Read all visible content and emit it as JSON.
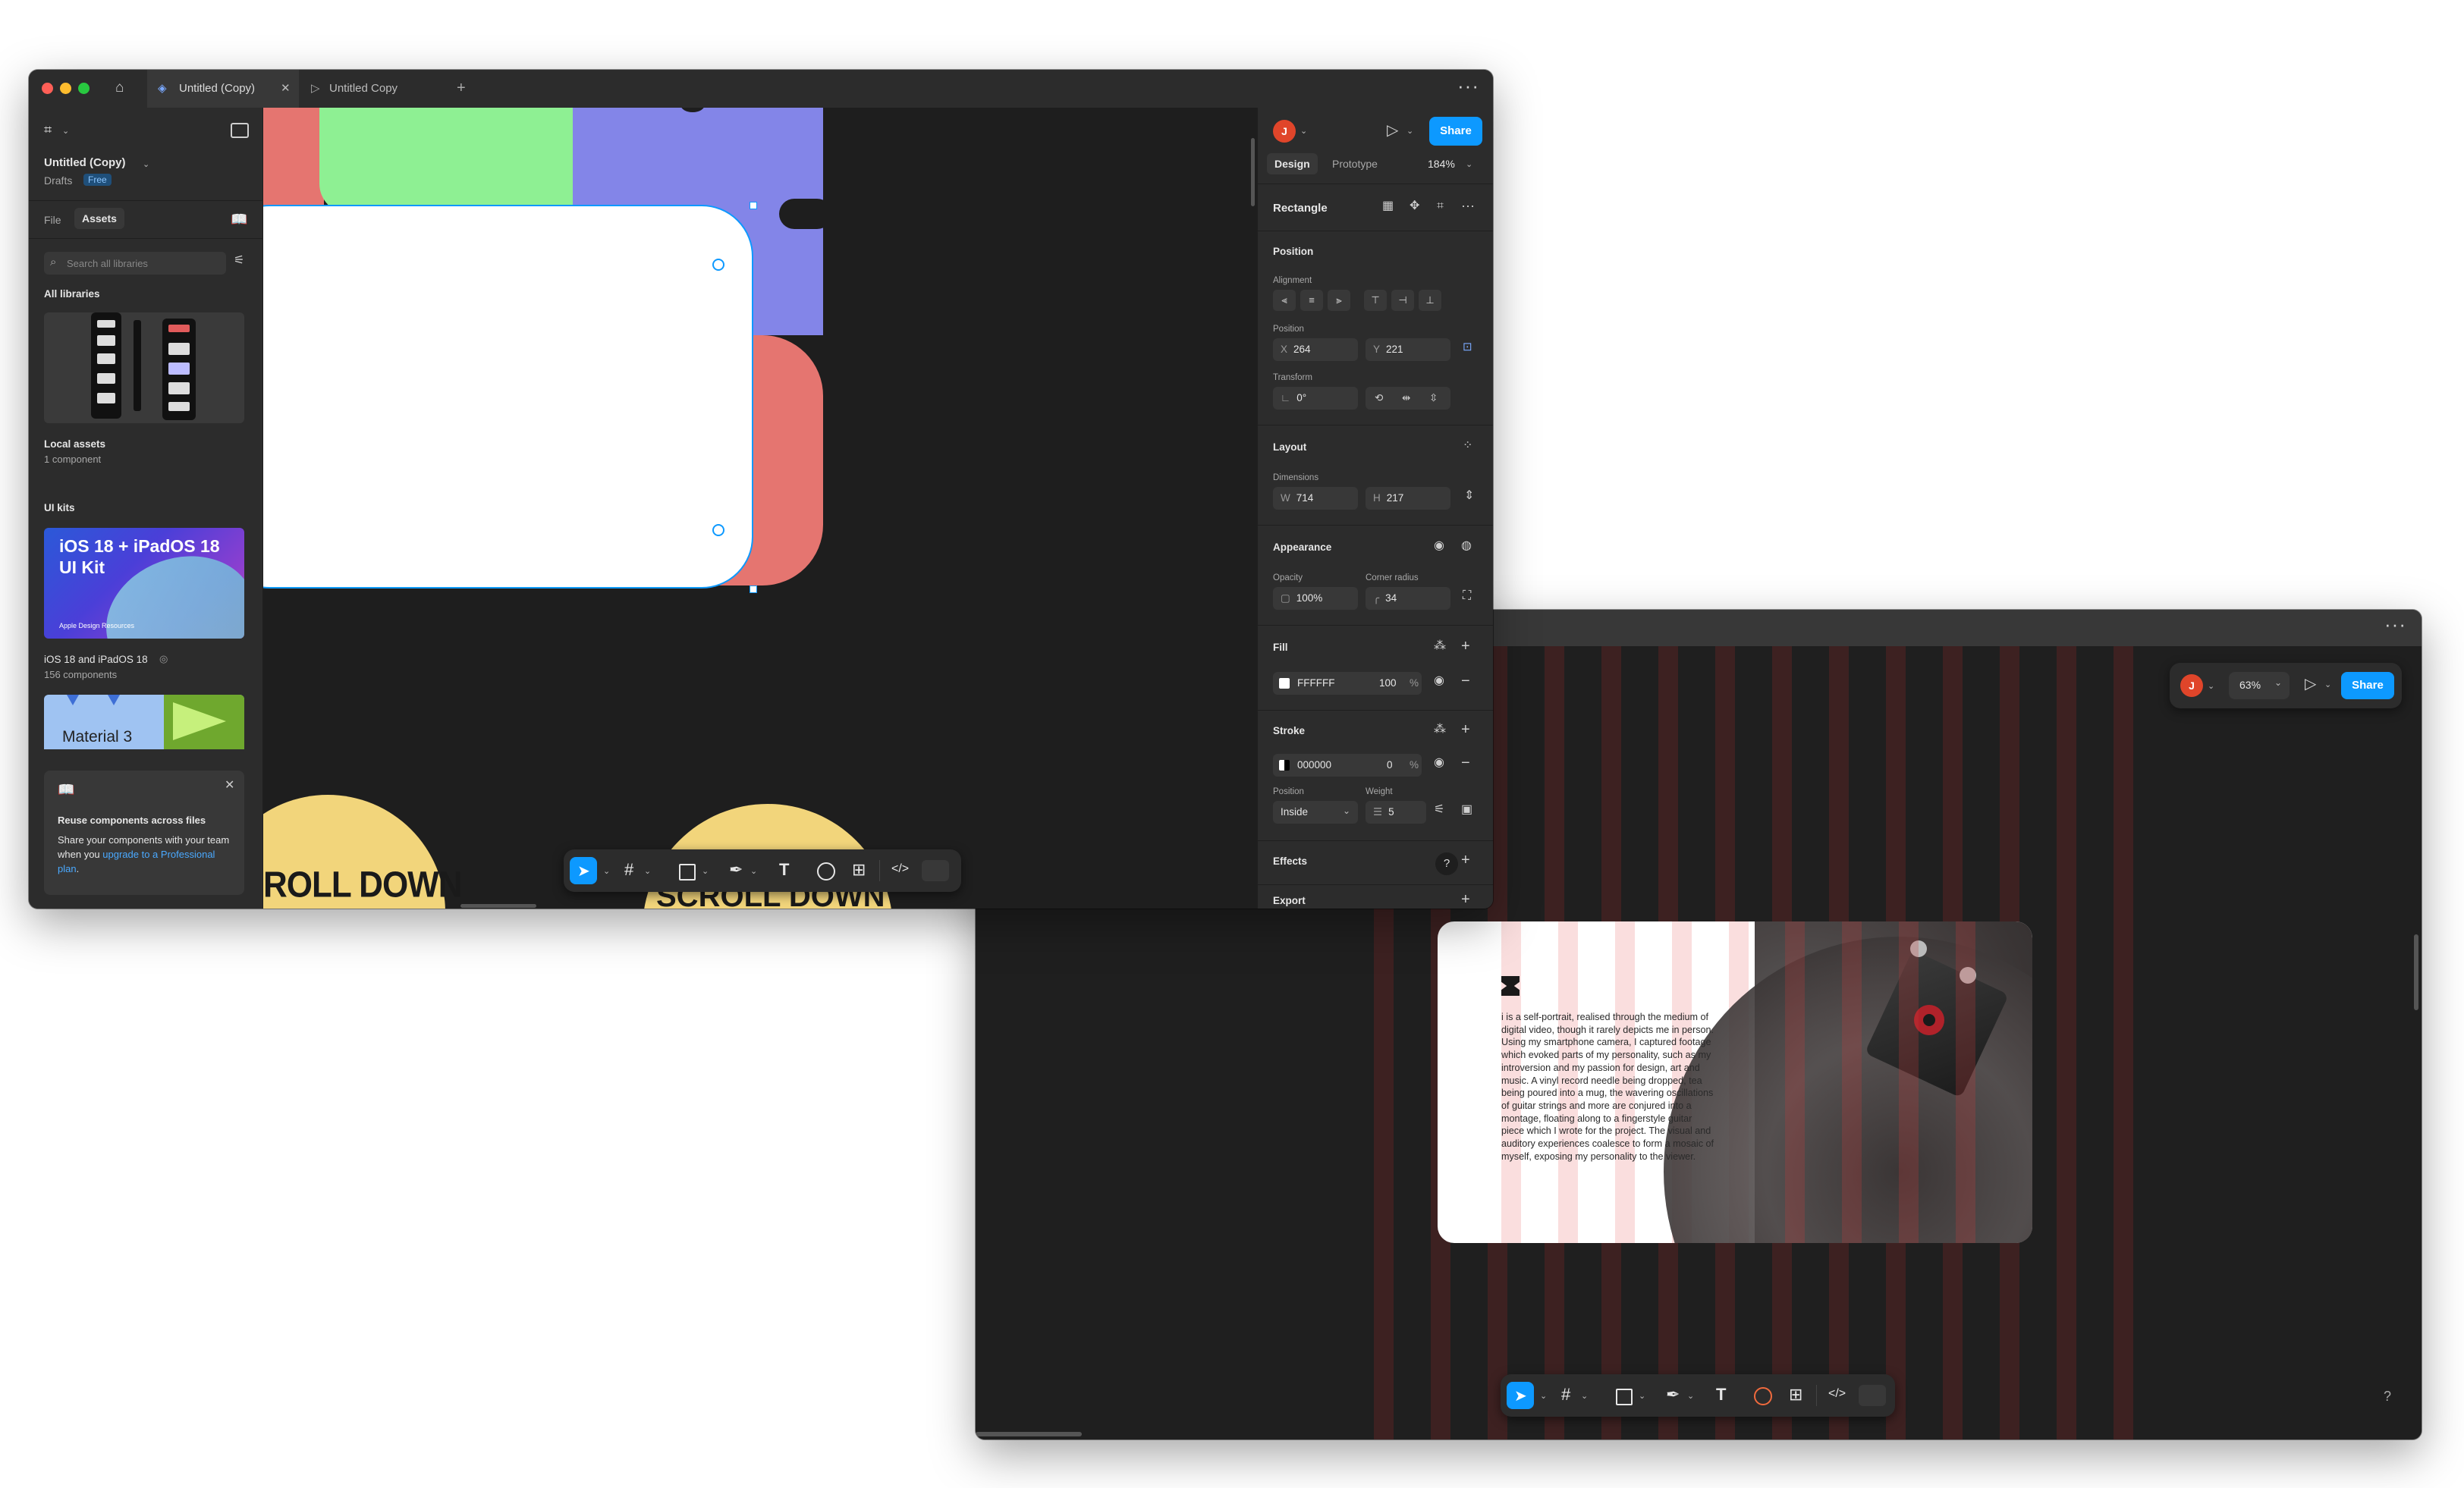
{
  "back_window": {
    "more_label": "···",
    "avatar_initial": "J",
    "zoom": "63%",
    "share_label": "Share",
    "help_label": "?",
    "card": {
      "body_text": "i is a self-portrait, realised through the medium of digital video, though it rarely depicts me in person. Using my smartphone camera, I captured footage which evoked parts of my personality, such as my introversion and my passion for design, art and music. A vinyl record needle being dropped, tea being poured into a mug, the wavering oscillations of guitar strings and more are conjured into a montage, floating along to a fingerstyle guitar piece which I wrote for the project. The visual and auditory experiences coalesce to form a mosaic of myself, exposing my personality to the viewer."
    }
  },
  "front_window": {
    "tabs": [
      {
        "label": "Untitled (Copy)",
        "icon": "figma-file-icon",
        "active": true,
        "close": "✕"
      },
      {
        "label": "Untitled Copy",
        "icon": "play-icon",
        "active": false
      }
    ],
    "new_tab_label": "+",
    "more_label": "···",
    "left_panel": {
      "file_title": "Untitled (Copy)",
      "location": "Drafts",
      "plan_badge": "Free",
      "tab_file": "File",
      "tab_assets": "Assets",
      "search_placeholder": "Search all libraries",
      "all_libraries_label": "All libraries",
      "local_assets": {
        "title": "Local assets",
        "subtitle": "1 component"
      },
      "ui_kits_label": "UI kits",
      "ios_kit": {
        "thumb_title": "iOS 18 + iPadOS 18 UI Kit",
        "thumb_footer": "Apple Design Resources",
        "title": "iOS 18 and iPadOS 18",
        "subtitle": "156 components"
      },
      "material_kit": {
        "thumb_title": "Material 3"
      },
      "promo": {
        "title": "Reuse components across files",
        "body": "Share your components with your team when you",
        "link": "upgrade to a Professional plan",
        "end": "."
      }
    },
    "canvas": {
      "text_left": "ROLL DOWN",
      "text_right": "SCROLL DOWN"
    },
    "right_panel": {
      "avatar_initial": "J",
      "share_label": "Share",
      "tab_design": "Design",
      "tab_prototype": "Prototype",
      "zoom": "184%",
      "layer_name": "Rectangle",
      "position_section": "Position",
      "alignment_label": "Alignment",
      "position_label": "Position",
      "x_prefix": "X",
      "x_value": "264",
      "y_prefix": "Y",
      "y_value": "221",
      "transform_label": "Transform",
      "rotation_value": "0°",
      "layout_section": "Layout",
      "dimensions_label": "Dimensions",
      "w_prefix": "W",
      "w_value": "714",
      "h_prefix": "H",
      "h_value": "217",
      "appearance_section": "Appearance",
      "opacity_label": "Opacity",
      "opacity_value": "100%",
      "corner_radius_label": "Corner radius",
      "corner_radius_value": "34",
      "fill_section": "Fill",
      "fill_hex": "FFFFFF",
      "fill_opacity": "100",
      "percent": "%",
      "fill_color": "#ffffff",
      "stroke_section": "Stroke",
      "stroke_hex": "000000",
      "stroke_opacity": "0",
      "stroke_position_label": "Position",
      "stroke_position_value": "Inside",
      "stroke_weight_label": "Weight",
      "stroke_weight_value": "5",
      "effects_section": "Effects",
      "export_section": "Export",
      "help_label": "?"
    }
  },
  "colors": {
    "accent": "#0d99ff",
    "avatar": "#e0452a",
    "canvas_green": "#8ef093",
    "canvas_purple": "#8385e8",
    "canvas_red": "#e57570",
    "canvas_yellow": "#f2d57b"
  }
}
